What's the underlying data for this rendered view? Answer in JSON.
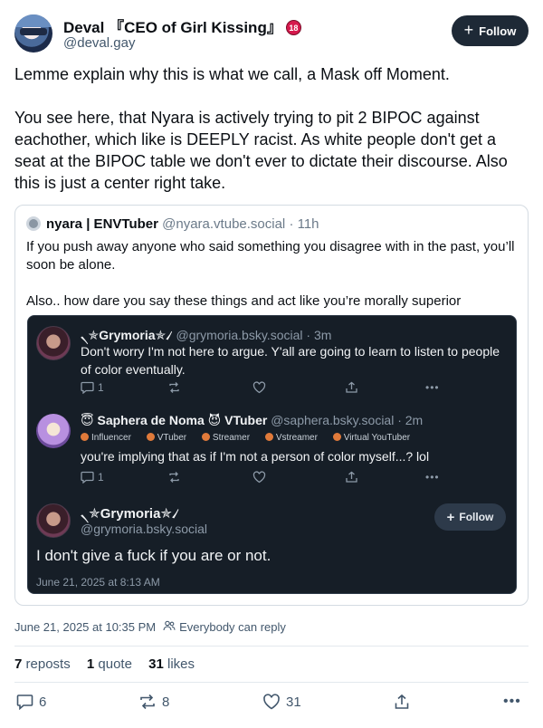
{
  "author": {
    "display_name": "Deval 『CEO of Girl Kissing』",
    "age_badge": "18",
    "handle": "@deval.gay",
    "follow_label": "Follow"
  },
  "post": {
    "paragraphs": [
      "Lemme explain why this is what we call, a Mask off Moment.",
      "You see here, that Nyara is actively trying to pit 2 BIPOC against eachother, which like is DEEPLY racist. As white people don't get a seat at the BIPOC table we don't ever to dictate their discourse. Also this is just a center right take."
    ],
    "timestamp": "June 21, 2025 at 10:35 PM",
    "reply_setting": "Everybody can reply",
    "stats": {
      "reposts_count": "7",
      "reposts_label": "reposts",
      "quotes_count": "1",
      "quotes_label": "quote",
      "likes_count": "31",
      "likes_label": "likes"
    },
    "actions": {
      "replies": "6",
      "reposts": "8",
      "likes": "31"
    }
  },
  "quote": {
    "name": "nyara | ENVTuber",
    "handle": "@nyara.vtube.social",
    "age": "· 11h",
    "paragraphs": [
      "If you push away anyone who said something you disagree with in the past, you’ll soon be alone.",
      "Also.. how dare you say these things and act like you’re morally superior"
    ]
  },
  "screenshot": {
    "reply1": {
      "name": "৲✯Grymoria✯৴",
      "handle": "@grymoria.bsky.social",
      "age": "· 3m",
      "text": "Don't worry I'm not here to argue. Y'all are going to learn to listen to people of color eventually.",
      "replies": "1"
    },
    "reply2": {
      "name": "😇 Saphera de Noma 😈 VTuber",
      "handle": "@saphera.bsky.social",
      "age": "· 2m",
      "badges": [
        "Influencer",
        "VTuber",
        "Streamer",
        "Vstreamer",
        "Virtual YouTuber"
      ],
      "text": "you're implying that as if I'm not a person of color myself...? lol",
      "replies": "1"
    },
    "main": {
      "name": "৲✯Grymoria✯৴",
      "handle": "@grymoria.bsky.social",
      "follow_label": "Follow",
      "text": "I don't give a fuck if you are or not.",
      "date": "June 21, 2025 at 8:13 AM"
    }
  }
}
